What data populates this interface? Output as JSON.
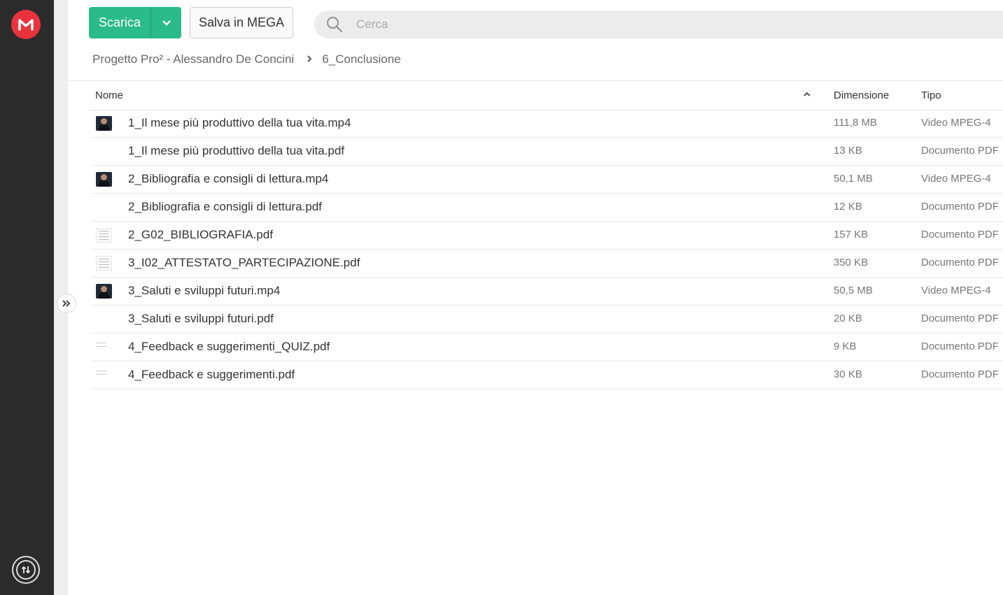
{
  "toolbar": {
    "download_label": "Scarica",
    "save_label": "Salva in MEGA"
  },
  "search": {
    "placeholder": "Cerca"
  },
  "breadcrumb": {
    "parent": "Progetto Pro² - Alessandro De Concini",
    "current": "6_Conclusione"
  },
  "table": {
    "headers": {
      "name": "Nome",
      "size": "Dimensione",
      "type": "Tipo"
    },
    "rows": [
      {
        "name": "1_Il mese più produttivo della tua vita.mp4",
        "size": "111,8 MB",
        "type": "Video MPEG-4",
        "thumb": "video"
      },
      {
        "name": "1_Il mese più produttivo della tua vita.pdf",
        "size": "13 KB",
        "type": "Documento PDF",
        "thumb": "none"
      },
      {
        "name": "2_Bibliografia e consigli di lettura.mp4",
        "size": "50,1 MB",
        "type": "Video MPEG-4",
        "thumb": "video"
      },
      {
        "name": "2_Bibliografia e consigli di lettura.pdf",
        "size": "12 KB",
        "type": "Documento PDF",
        "thumb": "none"
      },
      {
        "name": "2_G02_BIBLIOGRAFIA.pdf",
        "size": "157 KB",
        "type": "Documento PDF",
        "thumb": "doc"
      },
      {
        "name": "3_I02_ATTESTATO_PARTECIPAZIONE.pdf",
        "size": "350 KB",
        "type": "Documento PDF",
        "thumb": "doc"
      },
      {
        "name": "3_Saluti e sviluppi futuri.mp4",
        "size": "50,5 MB",
        "type": "Video MPEG-4",
        "thumb": "video"
      },
      {
        "name": "3_Saluti e sviluppi futuri.pdf",
        "size": "20 KB",
        "type": "Documento PDF",
        "thumb": "none"
      },
      {
        "name": "4_Feedback e suggerimenti_QUIZ.pdf",
        "size": "9 KB",
        "type": "Documento PDF",
        "thumb": "faint"
      },
      {
        "name": "4_Feedback e suggerimenti.pdf",
        "size": "30 KB",
        "type": "Documento PDF",
        "thumb": "faint"
      }
    ]
  },
  "colors": {
    "brand": "#e8333e",
    "download_button": "#2bba8a",
    "sidebar": "#2b2b2b"
  }
}
